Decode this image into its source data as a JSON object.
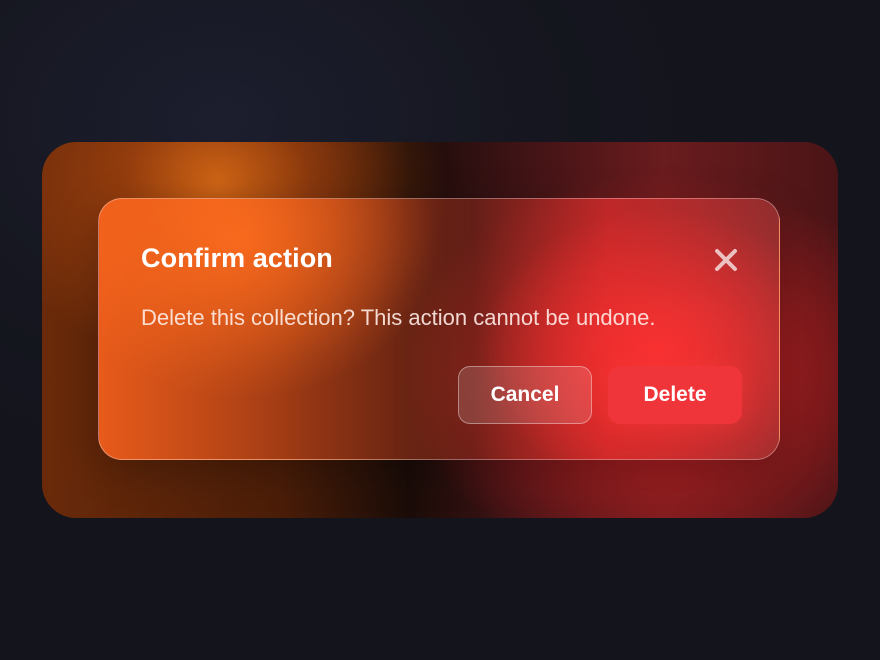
{
  "dialog": {
    "title": "Confirm action",
    "message": "Delete this collection? This action cannot be undone.",
    "close_icon": "close-icon",
    "cancel_label": "Cancel",
    "delete_label": "Delete"
  },
  "colors": {
    "page_background": "#15161f",
    "delete_button": "#f0353a",
    "accent_orange": "#ff6a1e",
    "text_primary": "#ffffff"
  }
}
